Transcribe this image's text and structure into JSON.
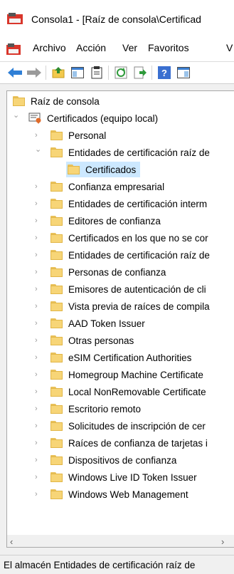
{
  "window": {
    "title": "Consola1 - [Raíz de consola\\Certificad"
  },
  "menu": {
    "items": [
      "Archivo",
      "Acción",
      "Ver",
      "Favoritos",
      "V"
    ]
  },
  "toolbar": {
    "buttons": [
      "back-icon",
      "forward-icon",
      "up-folder-icon",
      "show-hide-tree-icon",
      "clipboard-icon",
      "refresh-icon",
      "export-icon",
      "help-icon",
      "show-action-pane-icon"
    ]
  },
  "tree": {
    "root": "Raíz de consola",
    "store": "Certificados (equipo local)",
    "items": [
      "Personal",
      "Entidades de certificación raíz de",
      "Certificados",
      "Confianza empresarial",
      "Entidades de certificación interm",
      "Editores de confianza",
      "Certificados en los que no se cor",
      "Entidades de certificación raíz de",
      "Personas de confianza",
      "Emisores de autenticación de cli",
      "Vista previa de raíces de compila",
      "AAD Token Issuer",
      "Otras personas",
      "eSIM Certification Authorities",
      "Homegroup Machine Certificate",
      "Local NonRemovable Certificate",
      "Escritorio remoto",
      "Solicitudes de inscripción de cer",
      "Raíces de confianza de tarjetas i",
      "Dispositivos de confianza",
      "Windows Live ID Token Issuer",
      "Windows Web Management"
    ]
  },
  "status": {
    "text": "El almacén Entidades de certificación raíz de"
  },
  "colors": {
    "selection": "#cce8ff",
    "folder": "#f7d577"
  }
}
